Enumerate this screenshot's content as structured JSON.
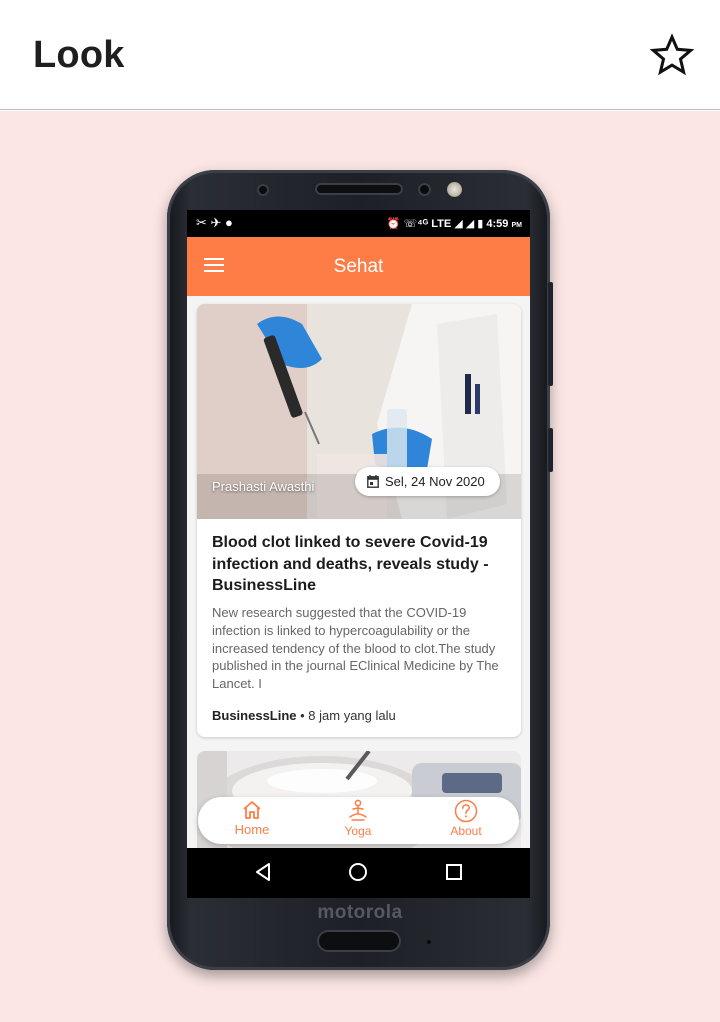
{
  "app": {
    "title": "Look",
    "favorite_icon": "star-outline-icon"
  },
  "phone": {
    "brand": "motorola"
  },
  "statusbar": {
    "left_icons": "✂ ✈ ●",
    "right_icons": "⏰ ☏⁴ᴳ LTE ◢ ◢ ▮",
    "time": "4:59",
    "ampm": "PM"
  },
  "screen_app": {
    "title": "Sehat",
    "menu_icon": "hamburger-menu-icon"
  },
  "article": {
    "author": "Prashasti Awasthi",
    "date": "Sel, 24 Nov 2020",
    "headline": "Blood clot linked to severe Covid-19 infection and deaths, reveals study - BusinessLine",
    "description": "New research suggested that the COVID-19 infection is linked to hypercoagulability or the increased tendency of the blood to clot.The study published in the journal EClinical Medicine by The Lancet. I",
    "source": "BusinessLine",
    "time_ago": " • 8 jam yang lalu"
  },
  "bottom_nav": {
    "items": [
      {
        "label": "Home",
        "icon": "home-icon"
      },
      {
        "label": "Yoga",
        "icon": "meditation-icon"
      },
      {
        "label": "About",
        "icon": "question-circle-icon"
      }
    ]
  },
  "colors": {
    "accent": "#fe7d47",
    "background": "#fbe6e4",
    "statusbar": "#000000"
  }
}
